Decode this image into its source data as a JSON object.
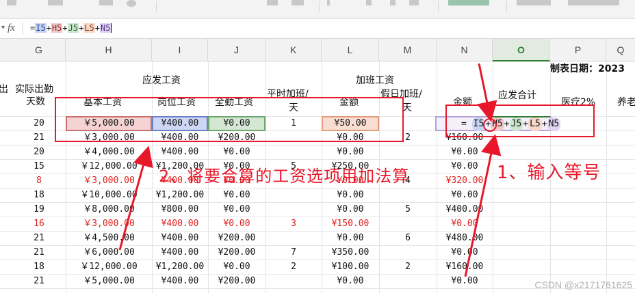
{
  "formula_bar": {
    "fx_label": "fx",
    "formula_parts": [
      "=",
      "I5",
      "+",
      "H5",
      "+",
      "J5",
      "+",
      "L5",
      "+",
      "N5"
    ]
  },
  "columns": [
    "G",
    "H",
    "I",
    "J",
    "K",
    "L",
    "M",
    "N",
    "O",
    "P",
    "Q"
  ],
  "active_column": "O",
  "sheet_headers": {
    "left_edge": "出",
    "actual_attendance": "实际出勤",
    "days": "天数",
    "payable_wage": "应发工资",
    "basic_wage": "基本工资",
    "position_wage": "岗位工资",
    "attendance_wage": "全勤工资",
    "overtime_wage": "加班工资",
    "weekday_overtime_1": "平时加班/",
    "weekday_overtime_2": "天",
    "amount": "金额",
    "holiday_overtime_1": "假日加班/",
    "holiday_overtime_2": "天",
    "amount_2": "金额",
    "payable_total": "应发合计",
    "medical": "医疗2%",
    "pension": "养老",
    "report_date": "制表日期：2023"
  },
  "rows": [
    {
      "G": "20",
      "H": "￥5,000.00",
      "I": "¥400.00",
      "J": "¥0.00",
      "K": "1",
      "L": "¥50.00",
      "M": "",
      "N": "",
      "red": false
    },
    {
      "G": "21",
      "H": "￥3,000.00",
      "I": "¥400.00",
      "J": "¥200.00",
      "K": "",
      "L": "¥0.00",
      "M": "2",
      "N": "¥160.00",
      "red": false
    },
    {
      "G": "20",
      "H": "￥4,000.00",
      "I": "¥400.00",
      "J": "¥0.00",
      "K": "",
      "L": "¥0.00",
      "M": "",
      "N": "¥0.00",
      "red": false
    },
    {
      "G": "15",
      "H": "￥12,000.00",
      "I": "¥1,200.00",
      "J": "¥0.00",
      "K": "5",
      "L": "¥250.00",
      "M": "",
      "N": "¥0.00",
      "red": false
    },
    {
      "G": "8",
      "H": "￥3,000.00",
      "I": "¥400.00",
      "J": "¥0.00",
      "K": "",
      "L": "¥0.00",
      "M": "4",
      "N": "¥320.00",
      "red": true
    },
    {
      "G": "18",
      "H": "￥10,000.00",
      "I": "¥1,200.00",
      "J": "¥0.00",
      "K": "",
      "L": "¥0.00",
      "M": "",
      "N": "¥0.00",
      "red": false
    },
    {
      "G": "19",
      "H": "￥8,000.00",
      "I": "¥800.00",
      "J": "¥0.00",
      "K": "",
      "L": "¥0.00",
      "M": "5",
      "N": "¥400.00",
      "red": false
    },
    {
      "G": "16",
      "H": "￥3,000.00",
      "I": "¥400.00",
      "J": "¥0.00",
      "K": "3",
      "L": "¥150.00",
      "M": "",
      "N": "¥0.00",
      "red": true
    },
    {
      "G": "21",
      "H": "￥4,500.00",
      "I": "¥400.00",
      "J": "¥200.00",
      "K": "",
      "L": "¥0.00",
      "M": "6",
      "N": "¥480.00",
      "red": false
    },
    {
      "G": "21",
      "H": "￥6,000.00",
      "I": "¥400.00",
      "J": "¥200.00",
      "K": "7",
      "L": "¥350.00",
      "M": "",
      "N": "¥0.00",
      "red": false
    },
    {
      "G": "18",
      "H": "￥12,000.00",
      "I": "¥1,200.00",
      "J": "¥0.00",
      "K": "2",
      "L": "¥100.00",
      "M": "2",
      "N": "¥160.00",
      "red": false
    },
    {
      "G": "21",
      "H": "￥5,000.00",
      "I": "¥400.00",
      "J": "¥200.00",
      "K": "",
      "L": "¥0.00",
      "M": "",
      "N": "¥0.00",
      "red": false
    }
  ],
  "cell_formula": {
    "eq": "=",
    "refs": [
      "I5",
      "H5",
      "J5",
      "L5",
      "N5"
    ],
    "plus": "+"
  },
  "annotations": {
    "step1": "1、输入等号",
    "step2": "2、将要合算的工资选项用加法算",
    "color": "#e8182a"
  },
  "watermark": "CSDN @x2171761625"
}
